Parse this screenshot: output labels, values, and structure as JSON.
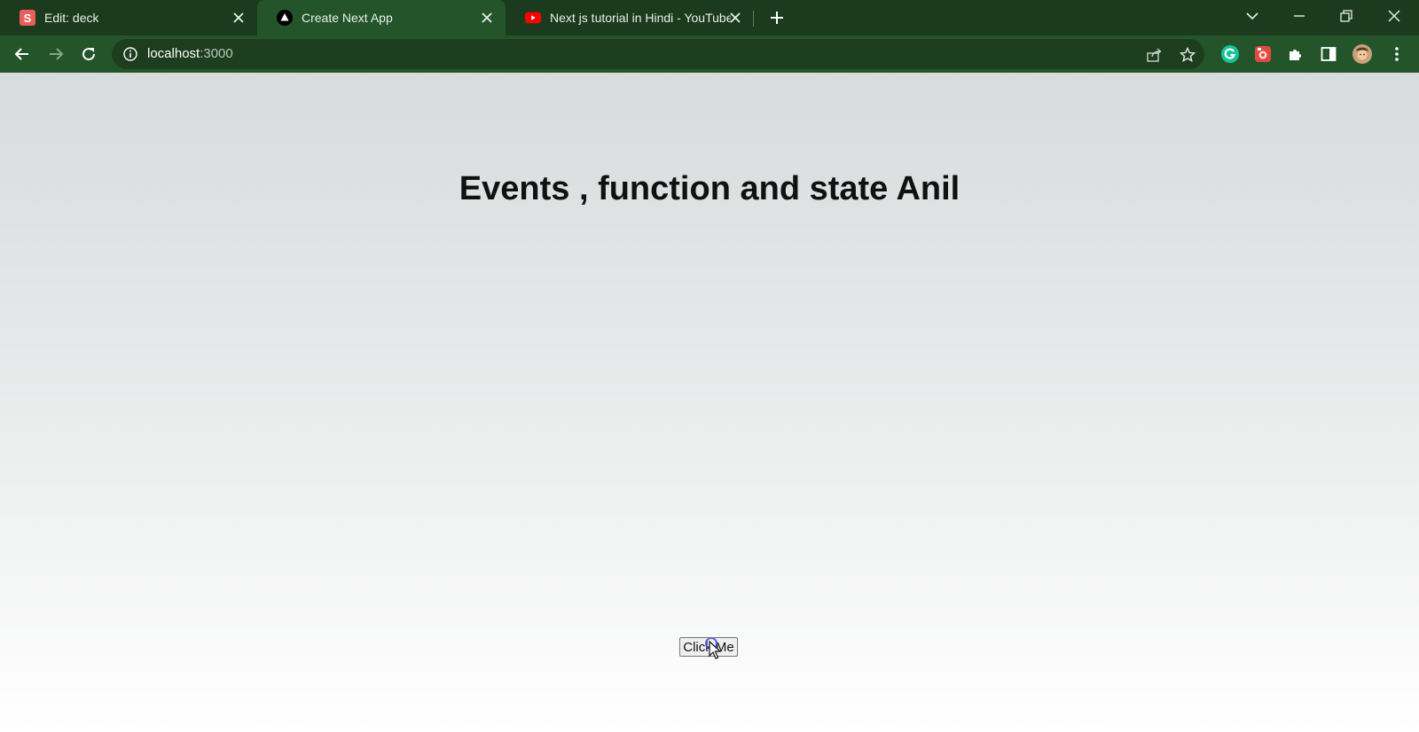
{
  "browser": {
    "tabs": [
      {
        "title": "Edit: deck",
        "favicon": "slides-s-icon",
        "favicon_letter": "S",
        "active": false
      },
      {
        "title": "Create Next App",
        "favicon": "nextjs-triangle-icon",
        "active": true
      },
      {
        "title": "Next js tutorial in Hindi - YouTube",
        "favicon": "youtube-icon",
        "active": false
      }
    ],
    "url_host": "localhost",
    "url_port": ":3000",
    "extensions": [
      "grammarly-icon",
      "screen-recorder-icon",
      "puzzle-icon",
      "side-panel-icon",
      "profile-avatar"
    ]
  },
  "page": {
    "heading": "Events , function and state Anil",
    "button_label": "Click Me"
  },
  "colors": {
    "tabstrip": "#1c3a1d",
    "toolbar": "#24552a",
    "omnibox": "#1d3d1f",
    "grammarly": "#15c39a",
    "youtube": "#ff0000",
    "slides": "#e8605c"
  }
}
